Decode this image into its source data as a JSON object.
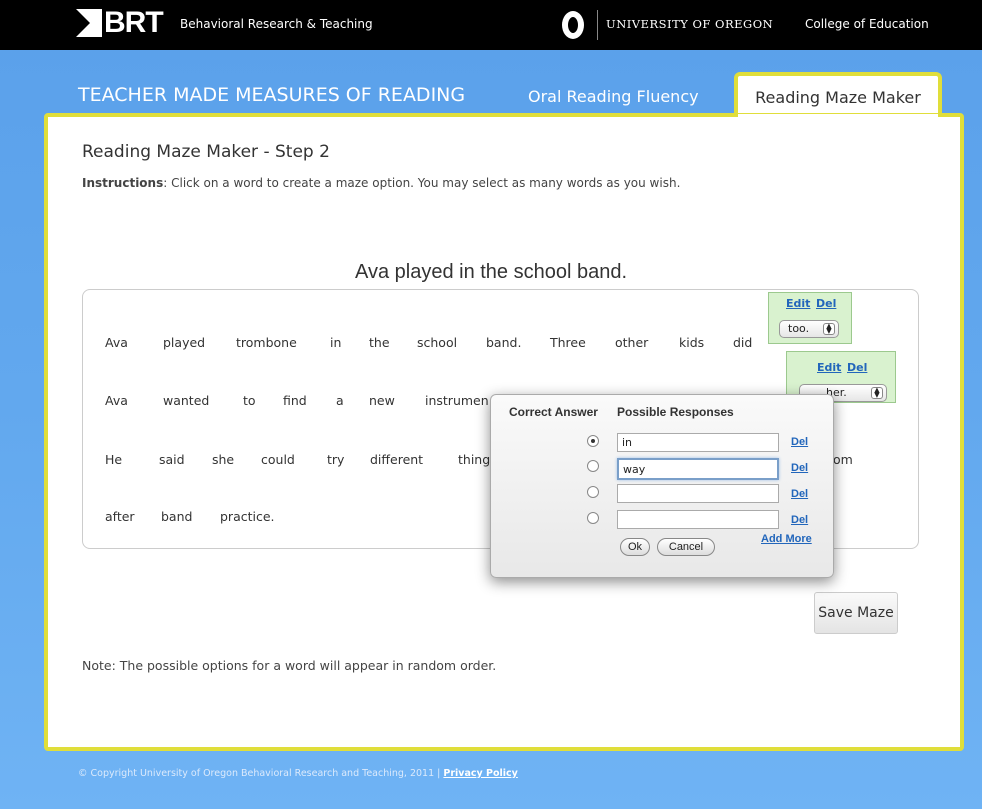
{
  "header": {
    "brt_logo_text": "BRT",
    "brt_subtitle": "Behavioral Research & Teaching",
    "university": "UNIVERSITY OF OREGON",
    "college": "College of Education"
  },
  "nav": {
    "title": "TEACHER MADE MEASURES OF READING",
    "orf_label": "Oral Reading Fluency",
    "active_tab": "Reading Maze Maker"
  },
  "main": {
    "heading": "Reading Maze Maker - Step 2",
    "instructions_label": "Instructions",
    "instructions_text": ": Click on a word to create a maze option. You may select as many words as you wish.",
    "sentence_title": "Ava played in the school band.",
    "line1": [
      "Ava",
      "played",
      "trombone",
      "in",
      "the",
      "school",
      "band.",
      "Three",
      "other",
      "kids",
      "did"
    ],
    "line2": [
      "Ava",
      "wanted",
      "to",
      "find",
      "a",
      "new",
      "instrumen"
    ],
    "line3": [
      "He",
      "said",
      "she",
      "could",
      "try",
      "different",
      "thing"
    ],
    "line3_tail": "om",
    "line4": [
      "after",
      "band",
      "practice."
    ],
    "maze1": {
      "edit": "Edit",
      "del": "Del",
      "value": "too."
    },
    "maze2": {
      "edit": "Edit",
      "del": "Del",
      "value": "her."
    },
    "save_button": "Save Maze",
    "note": "Note: The possible options for a word will appear in random order."
  },
  "popup": {
    "col_correct": "Correct Answer",
    "col_responses": "Possible Responses",
    "responses": [
      {
        "value": "in",
        "selected": true,
        "del": "Del"
      },
      {
        "value": "way",
        "selected": false,
        "del": "Del"
      },
      {
        "value": "",
        "selected": false,
        "del": "Del"
      },
      {
        "value": "",
        "selected": false,
        "del": "Del"
      }
    ],
    "ok": "Ok",
    "cancel": "Cancel",
    "add_more": "Add More"
  },
  "footer": {
    "copyright": "© Copyright University of Oregon Behavioral Research and Teaching, 2011 | ",
    "privacy": "Privacy Policy"
  },
  "colors": {
    "page_bg": "#62a8ee",
    "panel_border": "#e0de3a",
    "maze_bg": "#d9f2cf",
    "link": "#2266bb"
  }
}
